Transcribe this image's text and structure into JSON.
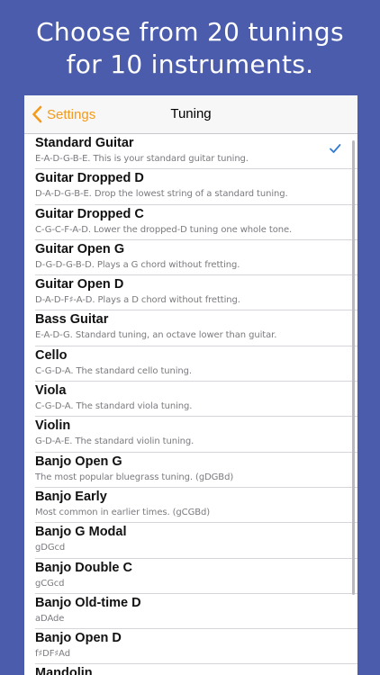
{
  "headline": {
    "line1": "Choose from 20 tunings",
    "line2": "for 10 instruments."
  },
  "navbar": {
    "back_label": "Settings",
    "title": "Tuning"
  },
  "accent_color": "#f49a1b",
  "background_color": "#4a5cab",
  "tunings": [
    {
      "name": "Standard Guitar",
      "desc": "E-A-D-G-B-E. This is your standard guitar tuning.",
      "selected": true
    },
    {
      "name": "Guitar Dropped D",
      "desc": "D-A-D-G-B-E. Drop the lowest string of a standard tuning."
    },
    {
      "name": "Guitar Dropped C",
      "desc": "C-G-C-F-A-D. Lower the dropped-D tuning one whole tone."
    },
    {
      "name": "Guitar Open G",
      "desc": "D-G-D-G-B-D. Plays a G chord without fretting."
    },
    {
      "name": "Guitar Open D",
      "desc": "D-A-D-F♯-A-D. Plays a D chord without fretting."
    },
    {
      "name": "Bass Guitar",
      "desc": "E-A-D-G. Standard tuning, an octave lower than guitar."
    },
    {
      "name": "Cello",
      "desc": "C-G-D-A. The standard cello tuning."
    },
    {
      "name": "Viola",
      "desc": "C-G-D-A. The standard viola tuning."
    },
    {
      "name": "Violin",
      "desc": "G-D-A-E. The standard violin tuning."
    },
    {
      "name": "Banjo Open G",
      "desc": "The most popular bluegrass tuning. (gDGBd)"
    },
    {
      "name": "Banjo Early",
      "desc": "Most common in earlier times. (gCGBd)"
    },
    {
      "name": "Banjo G Modal",
      "desc": "gDGcd"
    },
    {
      "name": "Banjo Double C",
      "desc": "gCGcd"
    },
    {
      "name": "Banjo Old-time D",
      "desc": "aDAde"
    },
    {
      "name": "Banjo Open D",
      "desc": "f♯DF♯Ad"
    },
    {
      "name": "Mandolin",
      "desc": ""
    }
  ],
  "icons": {
    "back": "chevron-left-icon",
    "selected": "checkmark-icon"
  }
}
